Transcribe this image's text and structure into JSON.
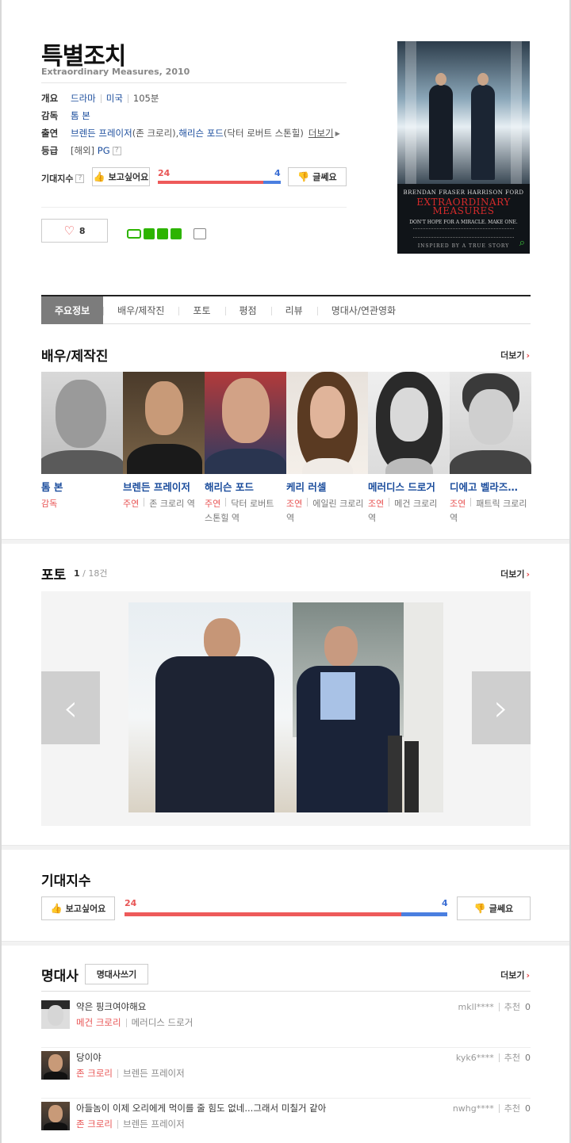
{
  "movie": {
    "title": "특별조치",
    "subtitle": "Extraordinary Measures, 2010"
  },
  "info": {
    "overview_label": "개요",
    "genre": "드라마",
    "country": "미국",
    "runtime": "105분",
    "director_label": "감독",
    "director": "톰 본",
    "cast_label": "출연",
    "cast1": "브렌든 프레이저",
    "cast1_role": "(존 크로리), ",
    "cast2": "해리슨 포드",
    "cast2_role": "(닥터 로버트 스톤힐)",
    "cast_more": "더보기",
    "rating_label": "등급",
    "rating_region": "[해외]",
    "rating": "PG",
    "expect_label": "기대지수"
  },
  "expect": {
    "want_label": "보고싶어요",
    "dislike_label": "글쎄요",
    "want_count": "24",
    "dislike_count": "4",
    "want_ratio": 0.857
  },
  "like": {
    "count": "8"
  },
  "poster": {
    "names": "BRENDAN FRASER      HARRISON FORD",
    "title1": "EXTRAORDINARY",
    "title2": "MEASURES",
    "tagline": "DON'T HOPE FOR A MIRACLE. MAKE ONE.",
    "inspired": "INSPIRED BY A TRUE STORY"
  },
  "tabs": [
    "주요정보",
    "배우/제작진",
    "포토",
    "평점",
    "리뷰",
    "명대사/연관영화"
  ],
  "cast_section": {
    "title": "배우/제작진",
    "more": "더보기",
    "members": [
      {
        "name": "톰 본",
        "role": "감독",
        "char": ""
      },
      {
        "name": "브렌든 프레이저",
        "role": "주연",
        "char": "존 크로리 역"
      },
      {
        "name": "해리슨 포드",
        "role": "주연",
        "char": "닥터 로버트 스톤힐 역"
      },
      {
        "name": "케리 러셀",
        "role": "조연",
        "char": "에일린 크로리 역"
      },
      {
        "name": "메러디스 드로거",
        "role": "조연",
        "char": "메건 크로리 역"
      },
      {
        "name": "디에고 벨라즈…",
        "role": "조연",
        "char": "패트릭 크로리 역"
      }
    ]
  },
  "photo_section": {
    "title": "포토",
    "current": "1",
    "total": " / 18건",
    "more": "더보기"
  },
  "expect_section": {
    "title": "기대지수"
  },
  "quotes": {
    "title": "명대사",
    "write_label": "명대사쓰기",
    "more": "더보기",
    "rec_label": "추천",
    "items": [
      {
        "text": "약은 핑크여야해요",
        "role": "메건 크로리",
        "actor": "메러디스 드로거",
        "user": "mkll****",
        "rec": "0"
      },
      {
        "text": "당이야",
        "role": "존 크로리",
        "actor": "브렌든 프레이저",
        "user": "kyk6****",
        "rec": "0"
      },
      {
        "text": "아들놈이 이제 오리에게 먹이를 줄 힘도 없네...그래서 미칠거 같아",
        "role": "존 크로리",
        "actor": "브렌든 프레이저",
        "user": "nwhg****",
        "rec": "0"
      }
    ]
  }
}
